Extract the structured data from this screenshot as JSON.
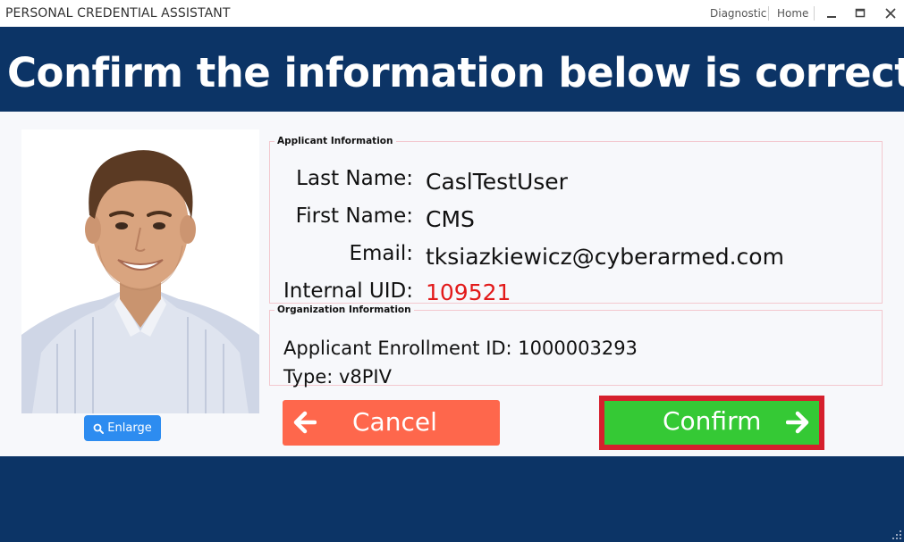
{
  "window": {
    "app_title": "PERSONAL CREDENTIAL ASSISTANT",
    "nav_links": [
      "Diagnostic",
      "Home"
    ],
    "controls": [
      "minimize-icon",
      "maximize-icon",
      "close-icon"
    ]
  },
  "header": {
    "title": "Confirm the information below is correct"
  },
  "photo": {
    "enlarge_label": "Enlarge",
    "enlarge_icon": "search-icon"
  },
  "applicant": {
    "legend": "Applicant Information",
    "last_name_label": "Last Name:",
    "last_name": "CaslTestUser",
    "first_name_label": "First Name:",
    "first_name": "CMS",
    "email_label": "Email:",
    "email": "tksiazkiewicz@cyberarmed.com",
    "uid_label": "Internal UID:",
    "uid": "109521"
  },
  "organization": {
    "legend": "Organization Information",
    "enrollment_line": "Applicant Enrollment ID: 1000003293",
    "type_line": "Type: v8PIV"
  },
  "actions": {
    "cancel_label": "Cancel",
    "cancel_icon": "arrow-left-icon",
    "confirm_label": "Confirm",
    "confirm_icon": "arrow-right-icon"
  },
  "colors": {
    "brand_navy": "#0c3466",
    "cancel_orange": "#fe674c",
    "confirm_green": "#35c935",
    "focus_red": "#d6202d",
    "uid_red": "#e21a1a",
    "enlarge_blue": "#2d8cf0"
  }
}
